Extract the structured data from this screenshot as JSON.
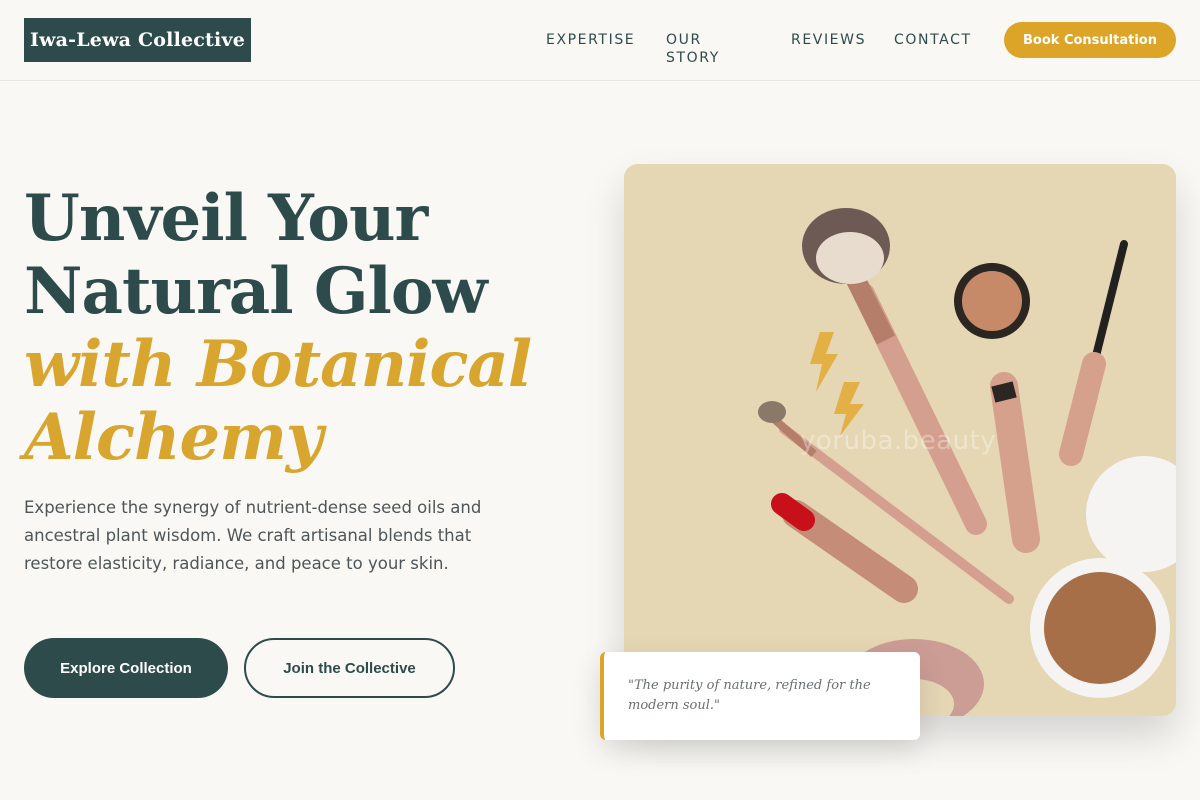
{
  "header": {
    "logo": "Iwa-Lewa Collective",
    "nav": [
      "EXPERTISE",
      "OUR STORY",
      "REVIEWS",
      "CONTACT"
    ],
    "cta": "Book Consultation"
  },
  "hero": {
    "title_line1": "Unveil Your",
    "title_line2": "Natural Glow",
    "title_line3": "with Botanical",
    "title_line4": "Alchemy",
    "description": "Experience the synergy of nutrient-dense seed oils and ancestral plant wisdom. We craft artisanal blends that restore elasticity, radiance, and peace to your skin.",
    "primary_button": "Explore Collection",
    "secondary_button": "Join the Collective"
  },
  "image": {
    "watermark": "yoruba.beauty",
    "background_color": "#e5d7b4"
  },
  "quote": {
    "text": "\"The purity of nature, refined for the modern soul.\""
  },
  "colors": {
    "primary": "#2e4b4c",
    "accent": "#dca527",
    "background": "#f9f8f4"
  }
}
